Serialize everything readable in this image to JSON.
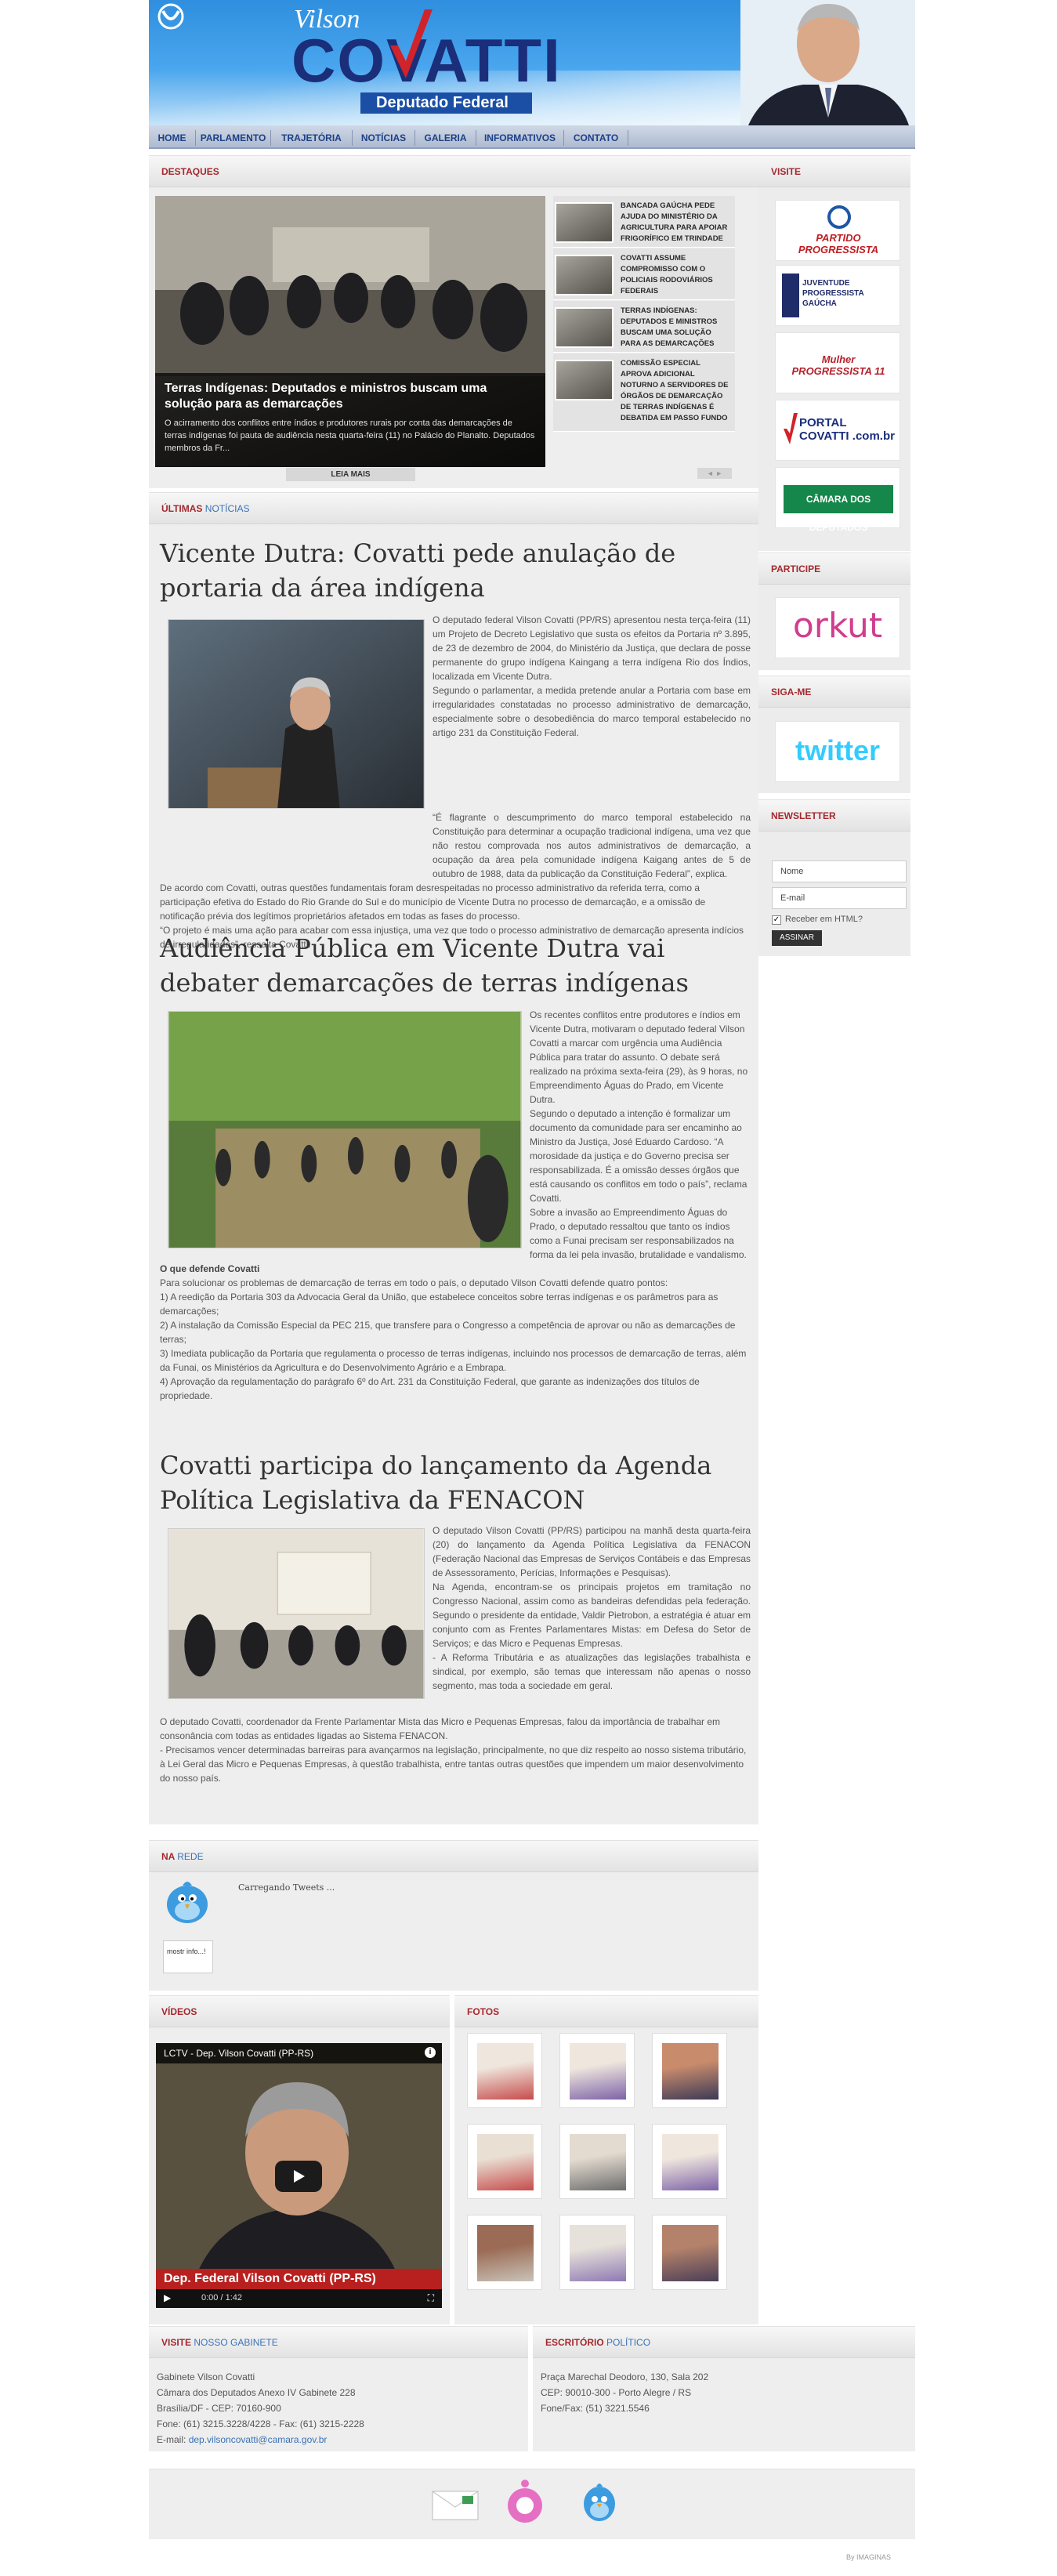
{
  "header": {
    "brand_first": "Vilson",
    "brand_last": "COVATTI",
    "brand_sub": "Deputado Federal"
  },
  "nav": {
    "items": [
      "HOME",
      "PARLAMENTO",
      "TRAJETÓRIA",
      "NOTÍCIAS",
      "GALERIA",
      "INFORMATIVOS",
      "CONTATO"
    ]
  },
  "destaques": {
    "heading": "DESTAQUES",
    "featured_title": "Terras Indígenas: Deputados e ministros buscam uma solução para as demarcações",
    "featured_text": "O acirramento dos conflitos entre índios e produtores rurais por conta das demarcações de terras indígenas foi pauta de audiência nesta quarta-feira (11) no Palácio do Planalto. Deputados membros da Fr...",
    "read_more": "LEIA MAIS",
    "items": [
      "BANCADA GAÚCHA PEDE AJUDA DO MINISTÉRIO DA AGRICULTURA PARA APOIAR FRIGORÍFICO EM TRINDADE",
      "COVATTI ASSUME COMPROMISSO COM O POLICIAIS RODOVIÁRIOS FEDERAIS",
      "TERRAS INDÍGENAS: DEPUTADOS E MINISTROS BUSCAM UMA SOLUÇÃO PARA AS DEMARCAÇÕES",
      "COMISSÃO ESPECIAL APROVA ADICIONAL NOTURNO A SERVIDORES DE ÓRGÃOS DE DEMARCAÇÃO DE TERRAS INDÍGENAS É DEBATIDA EM PASSO FUNDO"
    ],
    "pager": "◄ ►"
  },
  "noticias": {
    "heading_a": "ÚLTIMAS",
    "heading_b": "NOTÍCIAS",
    "articles": [
      {
        "title": "Vicente Dutra: Covatti pede anulação de portaria da área indígena",
        "paragraphs": [
          "O deputado federal Vilson Covatti (PP/RS) apresentou nesta terça-feira (11) um Projeto de Decreto Legislativo que susta os efeitos da Portaria nº 3.895, de 23 de dezembro de 2004, do Ministério da Justiça, que declara de posse permanente do grupo indígena Kaingang a terra indígena Rio dos Índios, localizada em Vicente Dutra.",
          "Segundo o parlamentar, a medida pretende anular a Portaria com base em irregularidades constatadas no processo administrativo de demarcação, especialmente sobre o desobediência do marco temporal estabelecido no artigo 231 da Constituição Federal.",
          "“É flagrante o descumprimento do marco temporal estabelecido na Constituição para determinar a ocupação tradicional indígena, uma vez que não restou comprovada nos autos administrativos de demarcação, a ocupação da área pela comunidade indígena Kaigang antes de 5 de outubro de 1988, data da publicação da Constituição Federal”, explica.",
          "De acordo com Covatti, outras questões fundamentais foram desrespeitadas no processo administrativo da referida terra, como a participação efetiva do Estado do Rio Grande do Sul e do município de Vicente Dutra no processo de demarcação, e a omissão de notificação prévia dos legítimos proprietários afetados em todas as fases do processo.",
          "“O projeto é mais uma ação para acabar com essa injustiça, uma vez que todo o processo administrativo de demarcação apresenta indícios de irregularidades”, ressalta Covatti."
        ]
      },
      {
        "title": "Audiência Pública em Vicente Dutra vai debater demarcações de terras indígenas",
        "paragraphs": [
          "Os recentes conflitos entre produtores e índios em Vicente Dutra, motivaram o deputado federal Vilson Covatti a marcar com urgência uma Audiência Pública para tratar do assunto. O debate será realizado na próxima sexta-feira (29), às 9 horas, no Empreendimento Águas do Prado, em Vicente Dutra.",
          "Segundo o deputado a intenção é formalizar um documento da comunidade para ser encaminho ao Ministro da Justiça, José Eduardo Cardoso. “A morosidade da justiça e do Governo precisa ser responsabilizada. É a omissão desses órgãos que está causando os conflitos em todo o país”, reclama Covatti.",
          "Sobre a invasão ao Empreendimento Águas do Prado, o deputado ressaltou que tanto os índios como a Funai precisam ser responsabilizados na forma da lei pela invasão, brutalidade e vandalismo."
        ],
        "subheading": "O que defende Covatti",
        "lead": "Para solucionar os problemas de demarcação de terras em todo o país, o deputado Vilson Covatti defende quatro pontos:",
        "points": [
          "1) A reedição da Portaria 303 da Advocacia Geral da União, que estabelece conceitos sobre terras indígenas e os parâmetros para as demarcações;",
          "2) A instalação da Comissão Especial da PEC 215, que transfere para o Congresso a competência de aprovar ou não as demarcações de terras;",
          "3) Imediata publicação da Portaria que regulamenta o processo de terras indígenas, incluindo nos processos de demarcação de terras, além da Funai, os Ministérios da Agricultura e do Desenvolvimento Agrário e a Embrapa.",
          "4) Aprovação da regulamentação do parágrafo 6º do Art. 231 da Constituição Federal, que garante as indenizações dos títulos de propriedade."
        ]
      },
      {
        "title": "Covatti participa do lançamento da Agenda Política Legislativa da FENACON",
        "paragraphs": [
          "O deputado Vilson Covatti (PP/RS) participou na manhã desta quarta-feira (20) do lançamento da Agenda Política Legislativa da FENACON (Federação Nacional das Empresas de Serviços Contábeis e das Empresas de Assessoramento, Perícias, Informações e Pesquisas).",
          "Na Agenda, encontram-se os principais projetos em tramitação no Congresso Nacional, assim como as bandeiras defendidas pela federação. Segundo o presidente da entidade, Valdir Pietrobon, a estratégia é atuar em conjunto com as Frentes Parlamentares Mistas: em Defesa do Setor de Serviços; e das Micro e Pequenas Empresas.",
          "- A Reforma Tributária e as atualizações das legislações trabalhista e sindical, por exemplo, são temas que interessam não apenas o nosso segmento, mas toda a sociedade em geral.",
          "O deputado Covatti, coordenador da Frente Parlamentar Mista das Micro e Pequenas Empresas, falou da importância de trabalhar em consonância com todas as entidades ligadas ao Sistema FENACON.",
          "- Precisamos vencer determinadas barreiras para avançarmos na legislação, principalmente, no que diz respeito ao nosso sistema tributário, à Lei Geral das Micro e Pequenas Empresas, à questão trabalhista, entre tantas outras questões que impendem um maior desenvolvimento do nosso país."
        ]
      }
    ]
  },
  "rede": {
    "heading_a": "NA",
    "heading_b": "REDE",
    "loading": "Carregando Tweets ...",
    "bubble": "mostr info...!"
  },
  "videos": {
    "heading": "VÍDEOS",
    "player_title": "LCTV - Dep. Vilson Covatti (PP-RS)",
    "lower_third": "Dep. Federal Vilson Covatti (PP-RS)",
    "time": "0:00 / 1:42"
  },
  "fotos": {
    "heading": "FOTOS",
    "count": 9
  },
  "sidebar": {
    "visite_heading": "VISITE",
    "logos": [
      "PARTIDO PROGRESSISTA",
      "JUVENTUDE PROGRESSISTA GAÚCHA",
      "Mulher PROGRESSISTA 11",
      "PORTAL COVATTI .com.br",
      "CÂMARA DOS DEPUTADOS"
    ],
    "participe_heading": "PARTICIPE",
    "orkut": "orkut",
    "siga_heading": "SIGA-ME",
    "twitter": "twitter",
    "newsletter_heading": "NEWSLETTER",
    "name_placeholder": "Nome",
    "email_placeholder": "E-mail",
    "html_label": "Receber em HTML?",
    "subscribe": "ASSINAR"
  },
  "footer": {
    "gabinete_a": "VISITE",
    "gabinete_b": "NOSSO GABINETE",
    "gabinete_lines": [
      "Gabinete Vilson Covatti",
      "Câmara dos Deputados Anexo IV Gabinete 228",
      "Brasília/DF - CEP: 70160-900",
      "Fone: (61) 3215.3228/4228 - Fax: (61) 3215-2228"
    ],
    "email_label": "E-mail:",
    "email": "dep.vilsoncovatti@camara.gov.br",
    "escritorio_a": "ESCRITÓRIO",
    "escritorio_b": "POLÍTICO",
    "escritorio_lines": [
      "Praça Marechal Deodoro, 130, Sala 202",
      "CEP: 90010-300 - Porto Alegre / RS",
      "Fone/Fax: (51) 3221.5546"
    ],
    "credit": "By IMAGINAS"
  },
  "colors": {
    "accent_red": "#a4282e",
    "accent_blue": "#3a72b6",
    "brand_navy": "#1b2e7a"
  }
}
